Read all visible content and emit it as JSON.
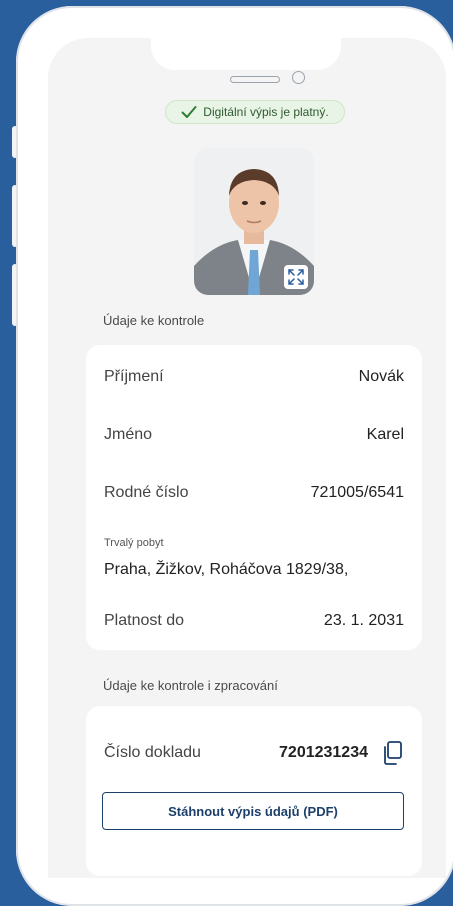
{
  "status": {
    "text": "Digitální výpis je platný."
  },
  "sections": {
    "check": "Údaje ke kontrole",
    "check_process": "Údaje ke kontrole i zpracování"
  },
  "person": {
    "surname_label": "Příjmení",
    "surname": "Novák",
    "name_label": "Jméno",
    "name": "Karel",
    "birth_label": "Rodné číslo",
    "birth": "721005/6541",
    "address_label": "Trvalý pobyt",
    "address": "Praha, Žižkov, Roháčova 1829/38,",
    "valid_label": "Platnost do",
    "valid": "23. 1. 2031"
  },
  "document": {
    "number_label": "Číslo dokladu",
    "number": "7201231234",
    "pdf_button": "Stáhnout výpis údajů (PDF)"
  },
  "icons": {
    "status": "check-icon",
    "photo_action": "expand-icon",
    "copy": "copy-icon"
  },
  "colors": {
    "background": "#2a5f9e",
    "accent": "#1d3f6b",
    "status_bg": "#e8f4e5",
    "status_check": "#2e7d32"
  }
}
